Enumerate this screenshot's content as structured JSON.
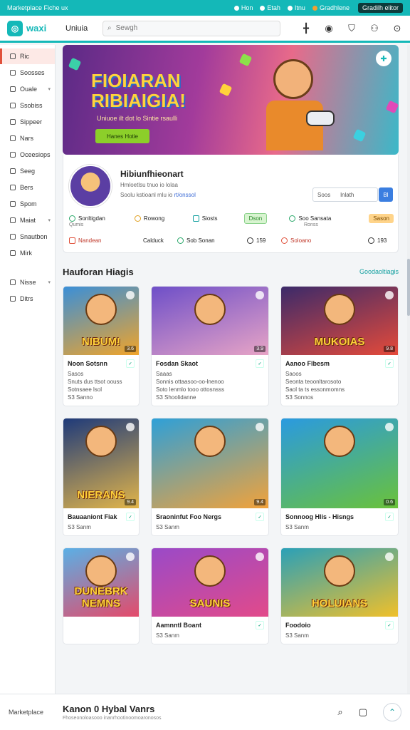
{
  "topbar": {
    "title": "Marketplace Fiche ux",
    "items": [
      "Hon",
      "Etah",
      "Itnu",
      "Gradhlene"
    ],
    "pill": "Gradilh elitor"
  },
  "header": {
    "logo": "waxi",
    "link": "Uniuia",
    "search_placeholder": "Sewgh"
  },
  "sidebar": {
    "items": [
      {
        "label": "Ric",
        "icon": "home-icon",
        "active": true
      },
      {
        "label": "Soosses",
        "icon": "shield-icon"
      },
      {
        "label": "Ouale",
        "icon": "calendar-icon",
        "chevron": true
      },
      {
        "label": "Ssobiss",
        "icon": "box-icon"
      },
      {
        "label": "Sippeer",
        "icon": "heart-icon"
      },
      {
        "label": "Nars",
        "icon": "search-icon"
      },
      {
        "label": "Oceesiops",
        "icon": "settings-icon"
      },
      {
        "label": "Seeg",
        "icon": "tag-icon"
      },
      {
        "label": "Bers",
        "icon": "card-icon"
      },
      {
        "label": "Spom",
        "icon": "link-icon"
      },
      {
        "label": "Maiat",
        "icon": "grid-icon",
        "chevron": true
      },
      {
        "label": "Snautbon",
        "icon": "document-icon"
      },
      {
        "label": "Mirk",
        "icon": "flag-icon"
      }
    ],
    "bottom": [
      {
        "label": "Nisse",
        "icon": "people-icon",
        "chevron": true
      },
      {
        "label": "Ditrs",
        "icon": "list-icon"
      }
    ]
  },
  "hero": {
    "title_line1": "FIOIARAN",
    "title_line2": "RIBIAIGIA!",
    "subtitle": "Uniuoe ilt dot lo Sintie rsaulli",
    "button": "Hanes Hotie"
  },
  "profile": {
    "name": "Hibiunfhieonart",
    "meta1": "Hmloetlsu tnuo io lolaa",
    "meta2_prefix": "Soolu kstioanl mlu io",
    "meta2_link": "rt/onssol",
    "input_left": "Soos",
    "input_right": "lnlath",
    "button": "Bl",
    "row1": [
      {
        "label": "Sonltigdan",
        "sub": "Qumis"
      },
      {
        "label": "Rowong"
      },
      {
        "label": "Siosts"
      },
      {
        "label": "Dson",
        "tag": true
      },
      {
        "label": "Soo Sansata",
        "sub": "Ronss"
      },
      {
        "label": "Sason",
        "tag": true
      }
    ],
    "row2": [
      {
        "label": "Nandean"
      },
      {
        "label": "Calduck"
      },
      {
        "label": "Sob Sonan"
      },
      {
        "label": "159"
      },
      {
        "label": "Soloano"
      },
      {
        "label": "193"
      }
    ]
  },
  "section": {
    "title": "Hauforan Hiagis",
    "link": "Goodaoltiagis"
  },
  "cards": [
    {
      "title": "Noon Sotsnn",
      "lines": [
        "Sasos",
        "Snuts dus ttsot oouss",
        "Sotnsaee lsol",
        "S3 Sanno"
      ],
      "thumb_text": "NIBUM!",
      "badge": "3.6",
      "bg": "linear-gradient(160deg,#3a8fd8,#f0a42a)"
    },
    {
      "title": "Fosdan Skaot",
      "lines": [
        "Saaas",
        "Sonnis ottaasoo-oo-lnenoo",
        "Soto lenmlo tooo ottosnsss",
        "S3 Shoolidanne"
      ],
      "thumb_text": "",
      "badge": "3.9",
      "bg": "linear-gradient(160deg,#6e4fc8,#e7a4c6)"
    },
    {
      "title": "Aanoo Flbesm",
      "lines": [
        "Saoos",
        "Seonta teoonltarosoto",
        "Saol ta ts essonmomns",
        "S3 Sonnos"
      ],
      "thumb_text": "MUKOIAS",
      "badge": "9.8",
      "bg": "linear-gradient(160deg,#3b2a6a,#e44a3a)"
    },
    {
      "title": "Bauaaniont Fiak",
      "lines": [
        "S3 Sanm"
      ],
      "thumb_text": "NIERANS",
      "badge": "9.4",
      "bg": "linear-gradient(160deg,#1e3a7a,#e2b54a)"
    },
    {
      "title": "Sraoninfut Foo Nergs",
      "lines": [
        "S3 Sanm"
      ],
      "thumb_text": "",
      "badge": "9.4",
      "bg": "linear-gradient(160deg,#2ea0d8,#f2a23a)"
    },
    {
      "title": "Sonnoog Hlis - Hisngs",
      "lines": [
        "S3 Sanm"
      ],
      "thumb_text": "",
      "badge": "0.6",
      "bg": "linear-gradient(160deg,#2a9ae0,#6ac23a)"
    },
    {
      "title": "",
      "lines": [],
      "thumb_text": "DUNEBRK NEMNS",
      "badge": "",
      "bg": "linear-gradient(160deg,#5ab0e6,#e44a6a)"
    },
    {
      "title": "Aamnntl Boant",
      "lines": [
        "S3 Sanm"
      ],
      "thumb_text": "SAUNIS",
      "badge": "",
      "bg": "linear-gradient(160deg,#9a4ac8,#e24a8a)"
    },
    {
      "title": "Foodoio",
      "lines": [
        "S3 Sanm"
      ],
      "thumb_text": "HOLUIANS",
      "badge": "",
      "bg": "linear-gradient(160deg,#2aa0b8,#f0c02a)"
    }
  ],
  "footer": {
    "left": "Marketplace",
    "title": "Kanon 0 Hybal Vanrs",
    "sub": "Fhoseonoloasooo inanrhootinoomoaronosos"
  },
  "colors": {
    "accent": "#14b8b8",
    "active": "#e0503a"
  }
}
